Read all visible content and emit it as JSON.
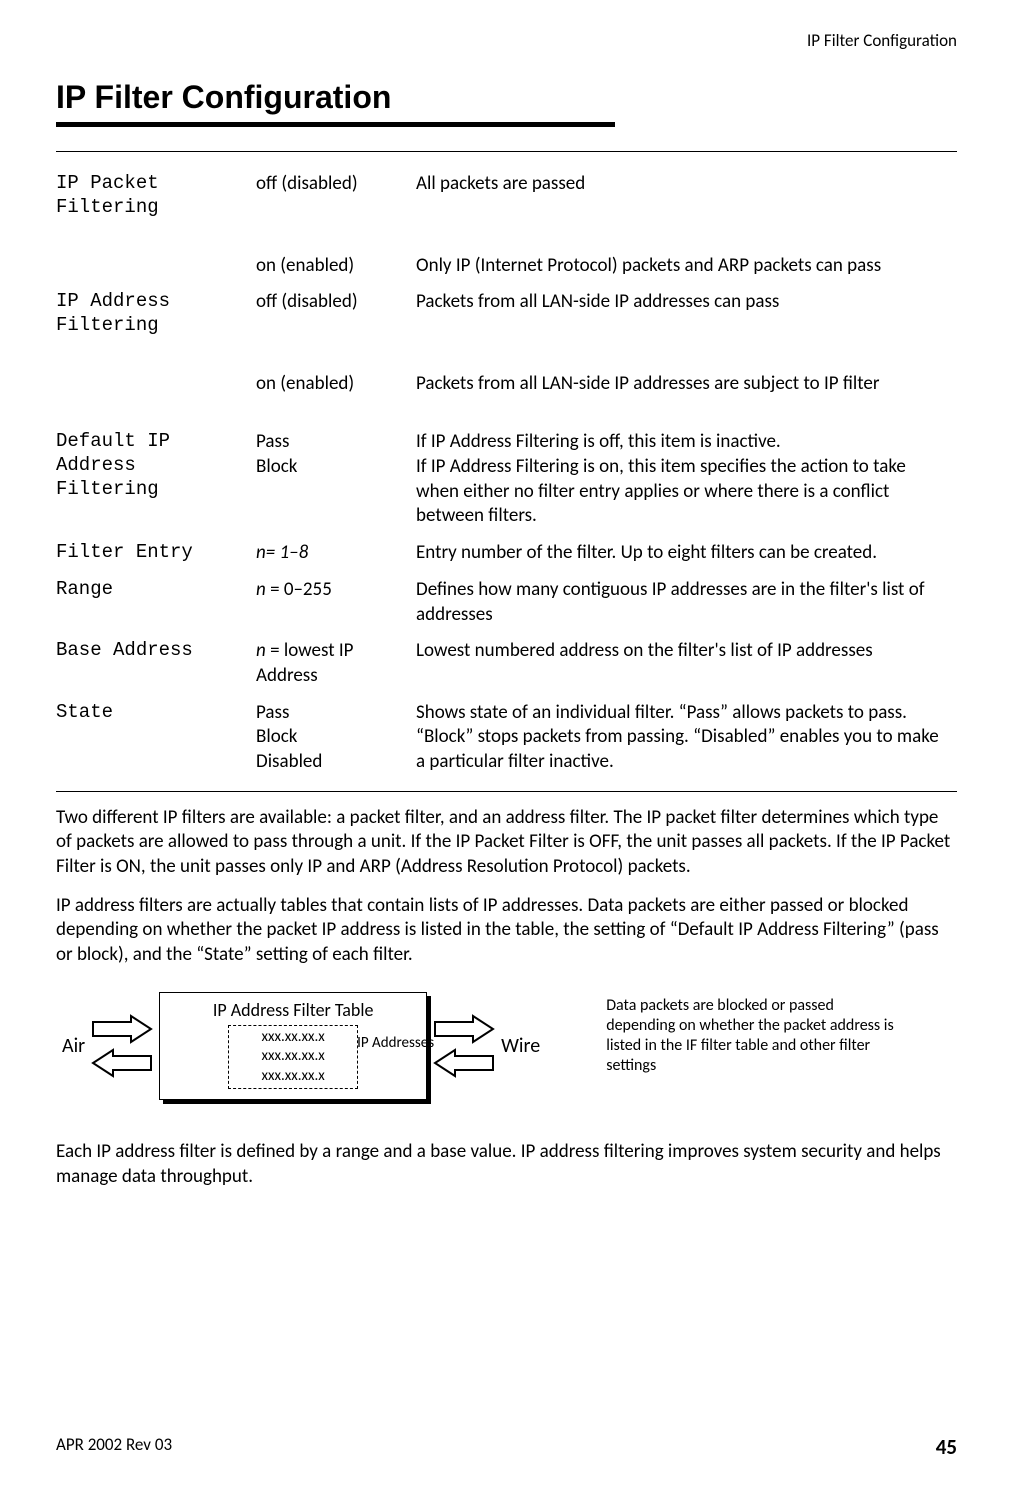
{
  "header": {
    "running": "IP Filter Configuration"
  },
  "title": "IP Filter Configuration",
  "rows": [
    {
      "name": "IP Packet\nFiltering",
      "val": "off (disabled)",
      "val_italic": "",
      "desc": "All packets are passed"
    },
    {
      "name": "",
      "val": "on (enabled)",
      "val_italic": "",
      "desc": "Only IP (Internet Protocol) packets and ARP packets can pass"
    },
    {
      "name": "IP Address\nFiltering",
      "val": "off (disabled)",
      "val_italic": "",
      "desc": "Packets from all LAN-side IP addresses can pass"
    },
    {
      "name": "",
      "val": "on (enabled)",
      "val_italic": "",
      "desc": "Packets from all LAN-side IP addresses are subject to IP filter"
    },
    {
      "name": "Default IP\nAddress\nFiltering",
      "val": "Pass\nBlock",
      "val_italic": "",
      "desc": "If IP Address Filtering is off, this item is inactive.\nIf IP Address Filtering is on, this item specifies the action to take when either no filter entry applies or where there is a conflict between filters."
    },
    {
      "name": "Filter Entry",
      "val_italic": "n= 1–8",
      "val": "",
      "desc": "Entry number of the filter. Up to eight filters can be created."
    },
    {
      "name": "Range",
      "val_italic": "n ",
      "val": "= 0–255",
      "desc": "Defines how many contiguous IP addresses are in the filter's list of addresses"
    },
    {
      "name": "Base Address",
      "val_italic": "n ",
      "val": "= lowest IP Address",
      "desc": "Lowest numbered address on the filter's list of IP addresses"
    },
    {
      "name": "State",
      "val": "Pass\nBlock\nDisabled",
      "val_italic": "",
      "desc": "Shows state of an individual filter. “Pass” allows packets to pass. “Block” stops packets from passing. “Disabled” enables you to make a particular filter inactive."
    }
  ],
  "para1": "Two different IP filters are available: a packet filter, and an address filter. The IP packet filter determines which type of packets are allowed to pass through a unit. If the IP Packet Filter is OFF, the unit passes all packets. If the IP Packet Filter is ON, the unit passes only IP and ARP (Address Resolution Protocol) packets.",
  "para2": "IP address filters are actually tables that contain lists of IP addresses. Data packets are either passed or blocked depending on whether the packet IP address is listed in the table, the setting of “Default IP Address Filtering” (pass or block), and the “State” setting of each filter.",
  "diagram": {
    "air": "Air",
    "wire": "Wire",
    "table_title": "IP Address Filter Table",
    "ip1": "xxx.xx.xx.x",
    "ip2": "xxx.xx.xx.x",
    "ip3": "xxx.xx.xx.x",
    "ip_label": "IP Addresses",
    "caption": "Data packets are blocked or passed depending on whether the packet address is listed in the IF filter table and other filter settings"
  },
  "para3": "Each IP address filter is defined by a range and a base value. IP address filtering improves system security and helps manage data throughput.",
  "footer": {
    "rev": "APR 2002 Rev 03",
    "page": "45"
  }
}
